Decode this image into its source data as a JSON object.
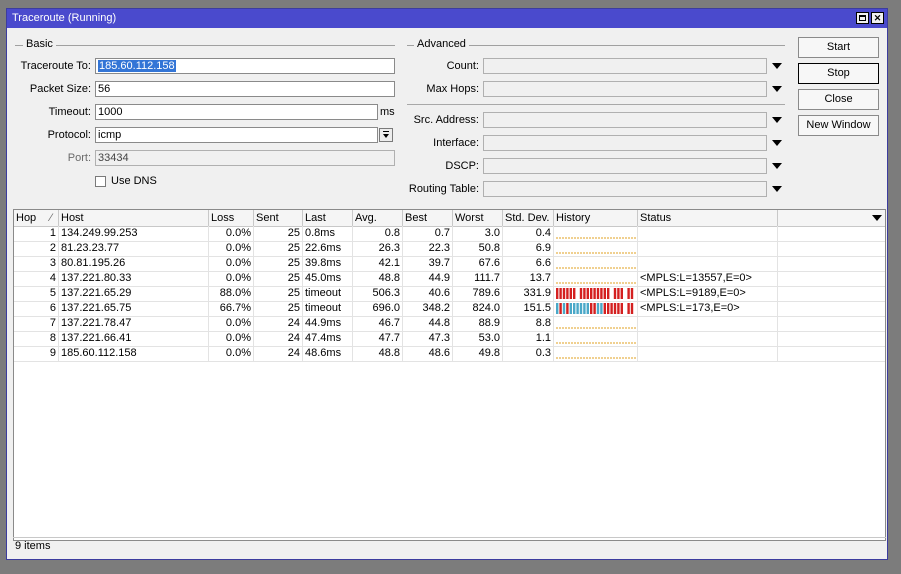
{
  "window": {
    "title": "Traceroute (Running)"
  },
  "basic": {
    "group_label": "Basic",
    "traceroute_to_label": "Traceroute To:",
    "traceroute_to_value": "185.60.112.158",
    "packet_size_label": "Packet Size:",
    "packet_size_value": "56",
    "timeout_label": "Timeout:",
    "timeout_value": "1000",
    "timeout_unit": "ms",
    "protocol_label": "Protocol:",
    "protocol_value": "icmp",
    "port_label": "Port:",
    "port_value": "33434",
    "use_dns_label": "Use DNS"
  },
  "advanced": {
    "group_label": "Advanced",
    "count_label": "Count:",
    "max_hops_label": "Max Hops:",
    "src_address_label": "Src. Address:",
    "interface_label": "Interface:",
    "dscp_label": "DSCP:",
    "routing_table_label": "Routing Table:"
  },
  "buttons": {
    "start": "Start",
    "stop": "Stop",
    "close": "Close",
    "new_window": "New Window"
  },
  "table": {
    "columns": [
      "Hop",
      "Host",
      "Loss",
      "Sent",
      "Last",
      "Avg.",
      "Best",
      "Worst",
      "Std. Dev.",
      "History",
      "Status"
    ],
    "rows": [
      {
        "hop": "1",
        "host": "134.249.99.253",
        "loss": "0.0%",
        "sent": "25",
        "last": "0.8ms",
        "avg": "0.8",
        "best": "0.7",
        "worst": "3.0",
        "std": "0.4",
        "history": "dashes",
        "status": ""
      },
      {
        "hop": "2",
        "host": "81.23.23.77",
        "loss": "0.0%",
        "sent": "25",
        "last": "22.6ms",
        "avg": "26.3",
        "best": "22.3",
        "worst": "50.8",
        "std": "6.9",
        "history": "dashes",
        "status": ""
      },
      {
        "hop": "3",
        "host": "80.81.195.26",
        "loss": "0.0%",
        "sent": "25",
        "last": "39.8ms",
        "avg": "42.1",
        "best": "39.7",
        "worst": "67.6",
        "std": "6.6",
        "history": "dashes",
        "status": ""
      },
      {
        "hop": "4",
        "host": "137.221.80.33",
        "loss": "0.0%",
        "sent": "25",
        "last": "45.0ms",
        "avg": "48.8",
        "best": "44.9",
        "worst": "111.7",
        "std": "13.7",
        "history": "dashes",
        "status": "<MPLS:L=13557,E=0>"
      },
      {
        "hop": "5",
        "host": "137.221.65.29",
        "loss": "88.0%",
        "sent": "25",
        "last": "timeout",
        "avg": "506.3",
        "best": "40.6",
        "worst": "789.6",
        "std": "331.9",
        "history": "red",
        "status": "<MPLS:L=9189,E=0>"
      },
      {
        "hop": "6",
        "host": "137.221.65.75",
        "loss": "66.7%",
        "sent": "25",
        "last": "timeout",
        "avg": "696.0",
        "best": "348.2",
        "worst": "824.0",
        "std": "151.5",
        "history": "mixed",
        "status": "<MPLS:L=173,E=0>"
      },
      {
        "hop": "7",
        "host": "137.221.78.47",
        "loss": "0.0%",
        "sent": "24",
        "last": "44.9ms",
        "avg": "46.7",
        "best": "44.8",
        "worst": "88.9",
        "std": "8.8",
        "history": "dashes",
        "status": ""
      },
      {
        "hop": "8",
        "host": "137.221.66.41",
        "loss": "0.0%",
        "sent": "24",
        "last": "47.4ms",
        "avg": "47.7",
        "best": "47.3",
        "worst": "53.0",
        "std": "1.1",
        "history": "dashes",
        "status": ""
      },
      {
        "hop": "9",
        "host": "185.60.112.158",
        "loss": "0.0%",
        "sent": "24",
        "last": "48.6ms",
        "avg": "48.8",
        "best": "48.6",
        "worst": "49.8",
        "std": "0.3",
        "history": "dashes",
        "status": ""
      }
    ]
  },
  "status_bar": {
    "items": "9 items"
  },
  "colors": {
    "titlebar": "#4a4acd",
    "history_timeout": "#d42020",
    "history_ok": "#4aa8c8",
    "history_dash": "#e0a020",
    "selection": "#3375d6"
  }
}
